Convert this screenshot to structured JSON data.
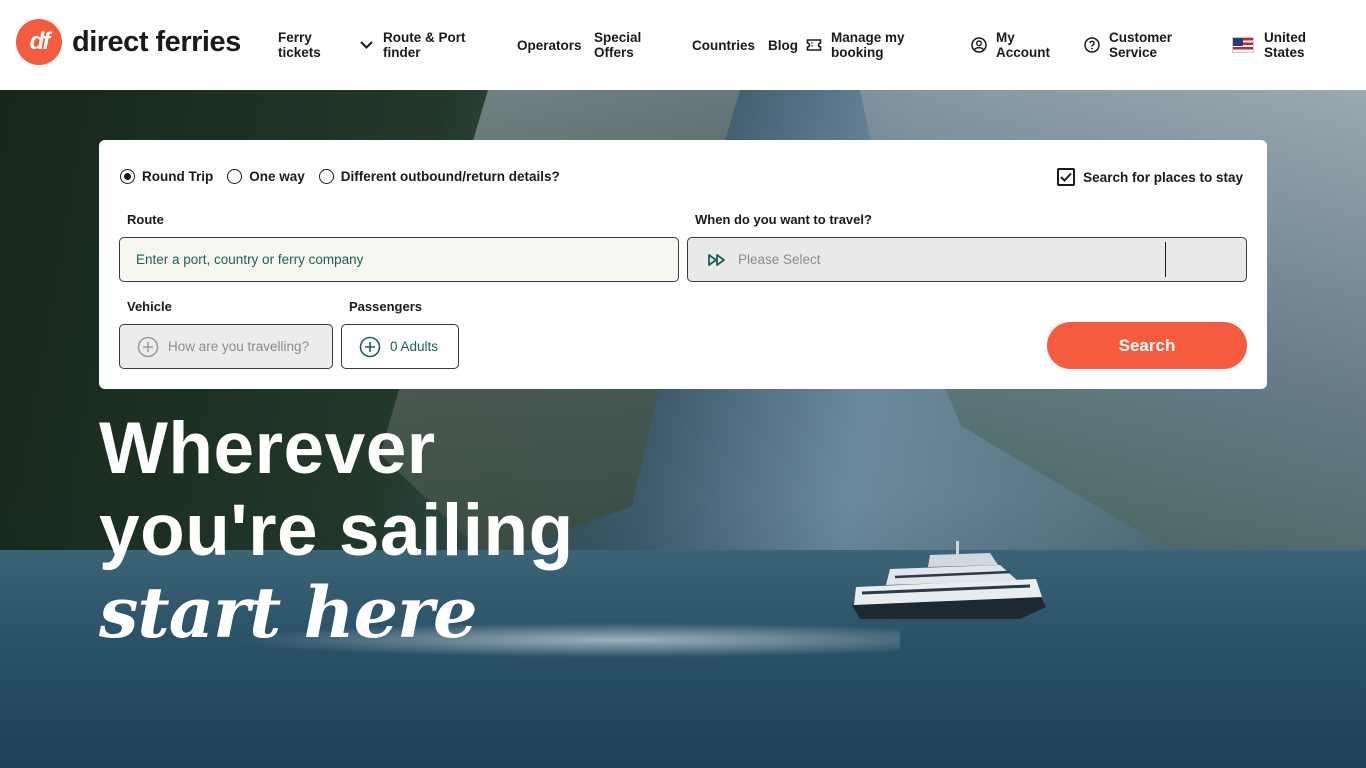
{
  "brand": {
    "logo_mark": "df",
    "name": "direct ferries",
    "accent_color": "#f45b3f"
  },
  "nav": {
    "ferry_tickets": "Ferry tickets",
    "route_finder": "Route & Port finder",
    "operators": "Operators",
    "special_offers": "Special Offers",
    "countries": "Countries",
    "blog": "Blog",
    "manage_booking": "Manage my booking",
    "my_account": "My Account",
    "customer_service": "Customer Service",
    "locale": "United States"
  },
  "search": {
    "trip_types": [
      "Round Trip",
      "One way",
      "Different outbound/return details?"
    ],
    "selected_trip_type": "Round Trip",
    "stay_label": "Search for places to stay",
    "stay_checked": true,
    "route_label": "Route",
    "route_placeholder": "Enter a port, country or ferry company",
    "date_label": "When do you want to travel?",
    "date_placeholder": "Please Select",
    "vehicle_label": "Vehicle",
    "vehicle_placeholder": "How are you travelling?",
    "passengers_label": "Passengers",
    "passengers_value": "0 Adults",
    "search_button": "Search"
  },
  "hero": {
    "line1": "Wherever",
    "line2": "you're sailing",
    "line3": "start here"
  },
  "icons": {
    "dropdown": "chevron-down-icon",
    "manage": "ticket-icon",
    "account": "user-circle-icon",
    "help": "question-circle-icon",
    "flag": "us-flag-icon",
    "date": "fast-forward-icon",
    "add": "plus-circle-icon"
  }
}
